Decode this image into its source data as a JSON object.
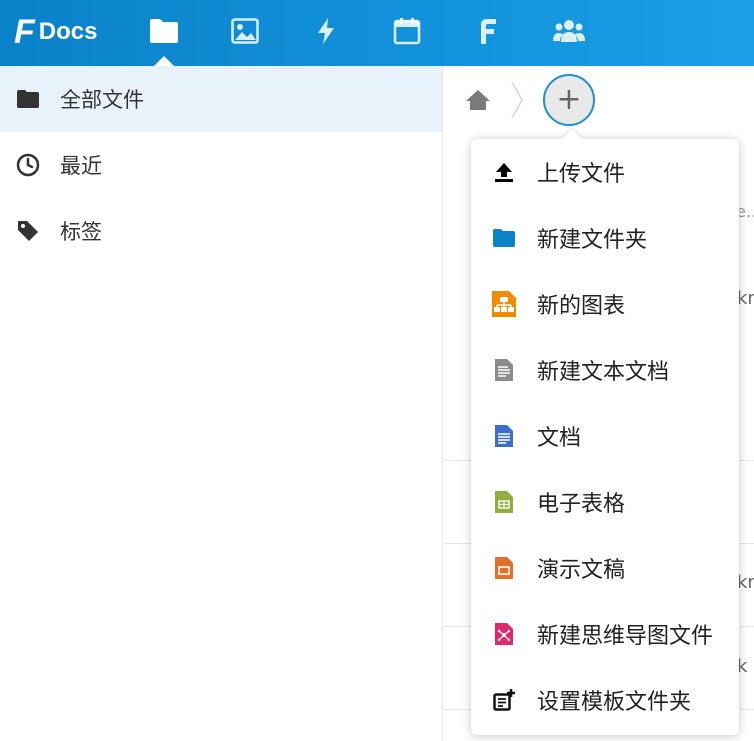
{
  "header": {
    "logo_letter": "F",
    "logo_text": "Docs",
    "apps": [
      {
        "icon": "folder-icon",
        "active": true
      },
      {
        "icon": "image-icon",
        "active": false
      },
      {
        "icon": "bolt-icon",
        "active": false
      },
      {
        "icon": "calendar-icon",
        "active": false
      },
      {
        "icon": "f-logo-icon",
        "active": false
      },
      {
        "icon": "users-icon",
        "active": false
      }
    ]
  },
  "sidebar": {
    "items": [
      {
        "label": "全部文件",
        "icon": "folder-icon",
        "active": true
      },
      {
        "label": "最近",
        "icon": "clock-icon",
        "active": false
      },
      {
        "label": "标签",
        "icon": "tag-icon",
        "active": false
      }
    ]
  },
  "breadcrumb": {
    "home_icon": "home-icon",
    "add_label": "+"
  },
  "menu": {
    "items": [
      {
        "label": "上传文件",
        "icon": "upload-icon",
        "color": "#000000"
      },
      {
        "label": "新建文件夹",
        "icon": "folder-icon",
        "color": "#0a82c8"
      },
      {
        "label": "新的图表",
        "icon": "diagram-icon",
        "color": "#f08c00"
      },
      {
        "label": "新建文本文档",
        "icon": "text-file-icon",
        "color": "#8c8c8c"
      },
      {
        "label": "文档",
        "icon": "document-icon",
        "color": "#3a6fcc"
      },
      {
        "label": "电子表格",
        "icon": "spreadsheet-icon",
        "color": "#8fae3c"
      },
      {
        "label": "演示文稿",
        "icon": "presentation-icon",
        "color": "#e0702c"
      },
      {
        "label": "新建思维导图文件",
        "icon": "mindmap-icon",
        "color": "#e0286c"
      },
      {
        "label": "设置模板文件夹",
        "icon": "template-folder-icon",
        "color": "#111111"
      }
    ]
  },
  "background_fragments": {
    "frag1": "e…",
    "frag2": "kn",
    "frag3": "kn",
    "frag4": "k"
  },
  "colors": {
    "header_blue": "#0a82c8",
    "accent": "#1b8fd8",
    "active_nav_bg": "#e8f2fb"
  }
}
